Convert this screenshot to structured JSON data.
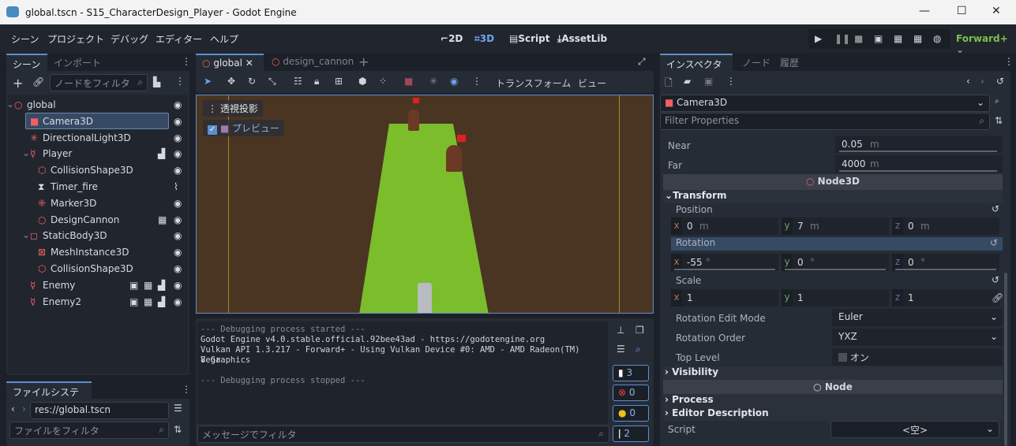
{
  "window": {
    "title": "global.tscn - S15_CharacterDesign_Player - Godot Engine",
    "min": "—",
    "max": "☐",
    "close": "✕"
  },
  "menu": [
    "シーン",
    "プロジェクト",
    "デバッグ",
    "エディター",
    "ヘルプ"
  ],
  "modes": {
    "2d": "2D",
    "3d": "3D",
    "script": "Script",
    "assetlib": "AssetLib"
  },
  "renderer": "Forward+",
  "scene_dock": {
    "tabs": [
      "シーン",
      "インポート"
    ],
    "filter_placeholder": "ノードをフィルタ",
    "tree": [
      {
        "name": "global",
        "icon": "node3d-icon"
      },
      {
        "name": "Camera3D",
        "icon": "camera-icon",
        "selected": true
      },
      {
        "name": "DirectionalLight3D",
        "icon": "light-icon"
      },
      {
        "name": "Player",
        "icon": "character-icon"
      },
      {
        "name": "CollisionShape3D",
        "icon": "collision-icon"
      },
      {
        "name": "Timer_fire",
        "icon": "timer-icon"
      },
      {
        "name": "Marker3D",
        "icon": "marker-icon"
      },
      {
        "name": "DesignCannon",
        "icon": "node3d-icon"
      },
      {
        "name": "StaticBody3D",
        "icon": "staticbody-icon"
      },
      {
        "name": "MeshInstance3D",
        "icon": "mesh-icon"
      },
      {
        "name": "CollisionShape3D",
        "icon": "collision-icon"
      },
      {
        "name": "Enemy",
        "icon": "character-icon"
      },
      {
        "name": "Enemy2",
        "icon": "character-icon"
      }
    ]
  },
  "filesystem": {
    "tab": "ファイルシステム",
    "path": "res://global.tscn",
    "filter_placeholder": "ファイルをフィルタ"
  },
  "editor_tabs": [
    {
      "label": "global",
      "active": true
    },
    {
      "label": "design_cannon"
    }
  ],
  "toolbar": {
    "transform": "トランスフォーム",
    "view": "ビュー"
  },
  "viewport": {
    "perspective": "透視投影",
    "preview": "プレビュー"
  },
  "output": {
    "lines": [
      "--- Debugging process started ---",
      "Godot Engine v4.0.stable.official.92bee43ad - https://godotengine.org",
      "Vulkan API 1.3.217 - Forward+ - Using Vulkan Device #0: AMD - AMD Radeon(TM) Vega",
      "8 Graphics",
      "",
      "--- Debugging process stopped ---"
    ],
    "filter_placeholder": "メッセージでフィルタ",
    "counts": {
      "messages": "3",
      "errors": "0",
      "warnings": "0",
      "editor": "2"
    }
  },
  "inspector": {
    "tabs": [
      "インスペクター",
      "ノード",
      "履歴"
    ],
    "node": "Camera3D",
    "filter_placeholder": "Filter Properties",
    "near_label": "Near",
    "near": "0.05",
    "far_label": "Far",
    "far": "4000",
    "unit_m": "m",
    "deg": "°",
    "node3d": "Node3D",
    "transform": "Transform",
    "position_label": "Position",
    "position": {
      "x": "0",
      "y": "7",
      "z": "0"
    },
    "rotation_label": "Rotation",
    "rotation": {
      "x": "-55",
      "y": "0",
      "z": "0"
    },
    "scale_label": "Scale",
    "scale": {
      "x": "1",
      "y": "1",
      "z": "1"
    },
    "rot_mode_label": "Rotation Edit Mode",
    "rot_mode": "Euler",
    "rot_order_label": "Rotation Order",
    "rot_order": "YXZ",
    "top_level_label": "Top Level",
    "top_level": "オン",
    "visibility": "Visibility",
    "node_header": "Node",
    "process": "Process",
    "editor_desc": "Editor Description",
    "script_label": "Script",
    "script": "<空>"
  }
}
